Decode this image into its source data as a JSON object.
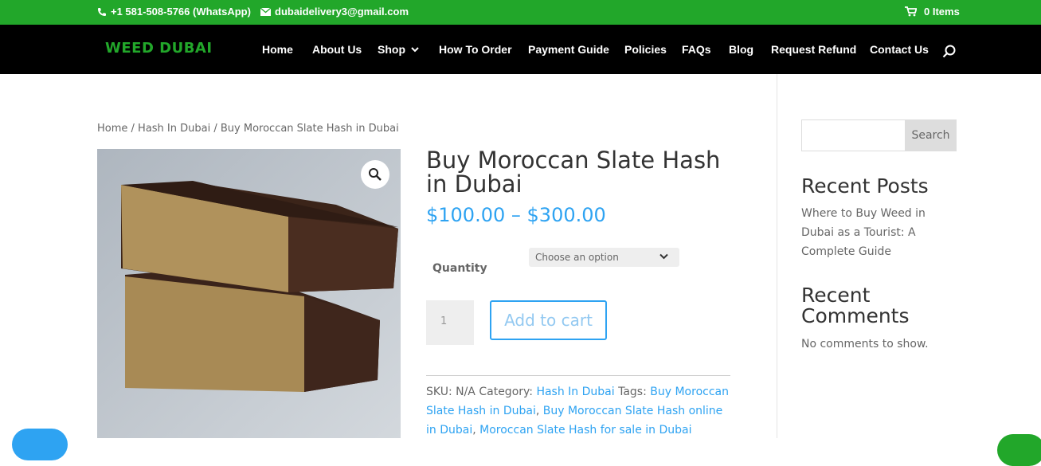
{
  "topbar": {
    "phone": "+1 581-508-5766 (WhatsApp)",
    "email": "dubaidelivery3@gmail.com",
    "cart": "0 Items"
  },
  "nav": {
    "logo": "WEED DUBAI",
    "items": [
      "Home",
      "About Us",
      "Shop",
      "How To Order",
      "Payment Guide",
      "Policies",
      "FAQs",
      "Blog",
      "Request Refund",
      "Contact Us"
    ]
  },
  "breadcrumb": {
    "home": "Home",
    "category": "Hash In Dubai",
    "current": "Buy Moroccan Slate Hash in Dubai"
  },
  "product": {
    "title": "Buy Moroccan Slate Hash in Dubai",
    "price_low": "$100.00",
    "price_sep": "–",
    "price_high": "$300.00",
    "quantity_label": "Quantity",
    "select_placeholder": "Choose an option",
    "qty_value": "1",
    "add_to_cart": "Add to cart",
    "sku_label": "SKU:",
    "sku_value": "N/A",
    "category_label": "Category:",
    "category": "Hash In Dubai",
    "tags_label": "Tags:",
    "tags": [
      "Buy Moroccan Slate Hash in Dubai",
      "Buy Moroccan Slate Hash online in Dubai",
      "Moroccan Slate Hash for sale in Dubai"
    ]
  },
  "sidebar": {
    "search_button": "Search",
    "recent_posts_title": "Recent Posts",
    "recent_post": "Where to Buy Weed in Dubai as a Tourist: A Complete Guide",
    "recent_comments_title": "Recent Comments",
    "no_comments": "No comments to show."
  },
  "colors": {
    "topbar": "#22a72a",
    "accent": "#2ea3f2",
    "nav": "#000000"
  }
}
